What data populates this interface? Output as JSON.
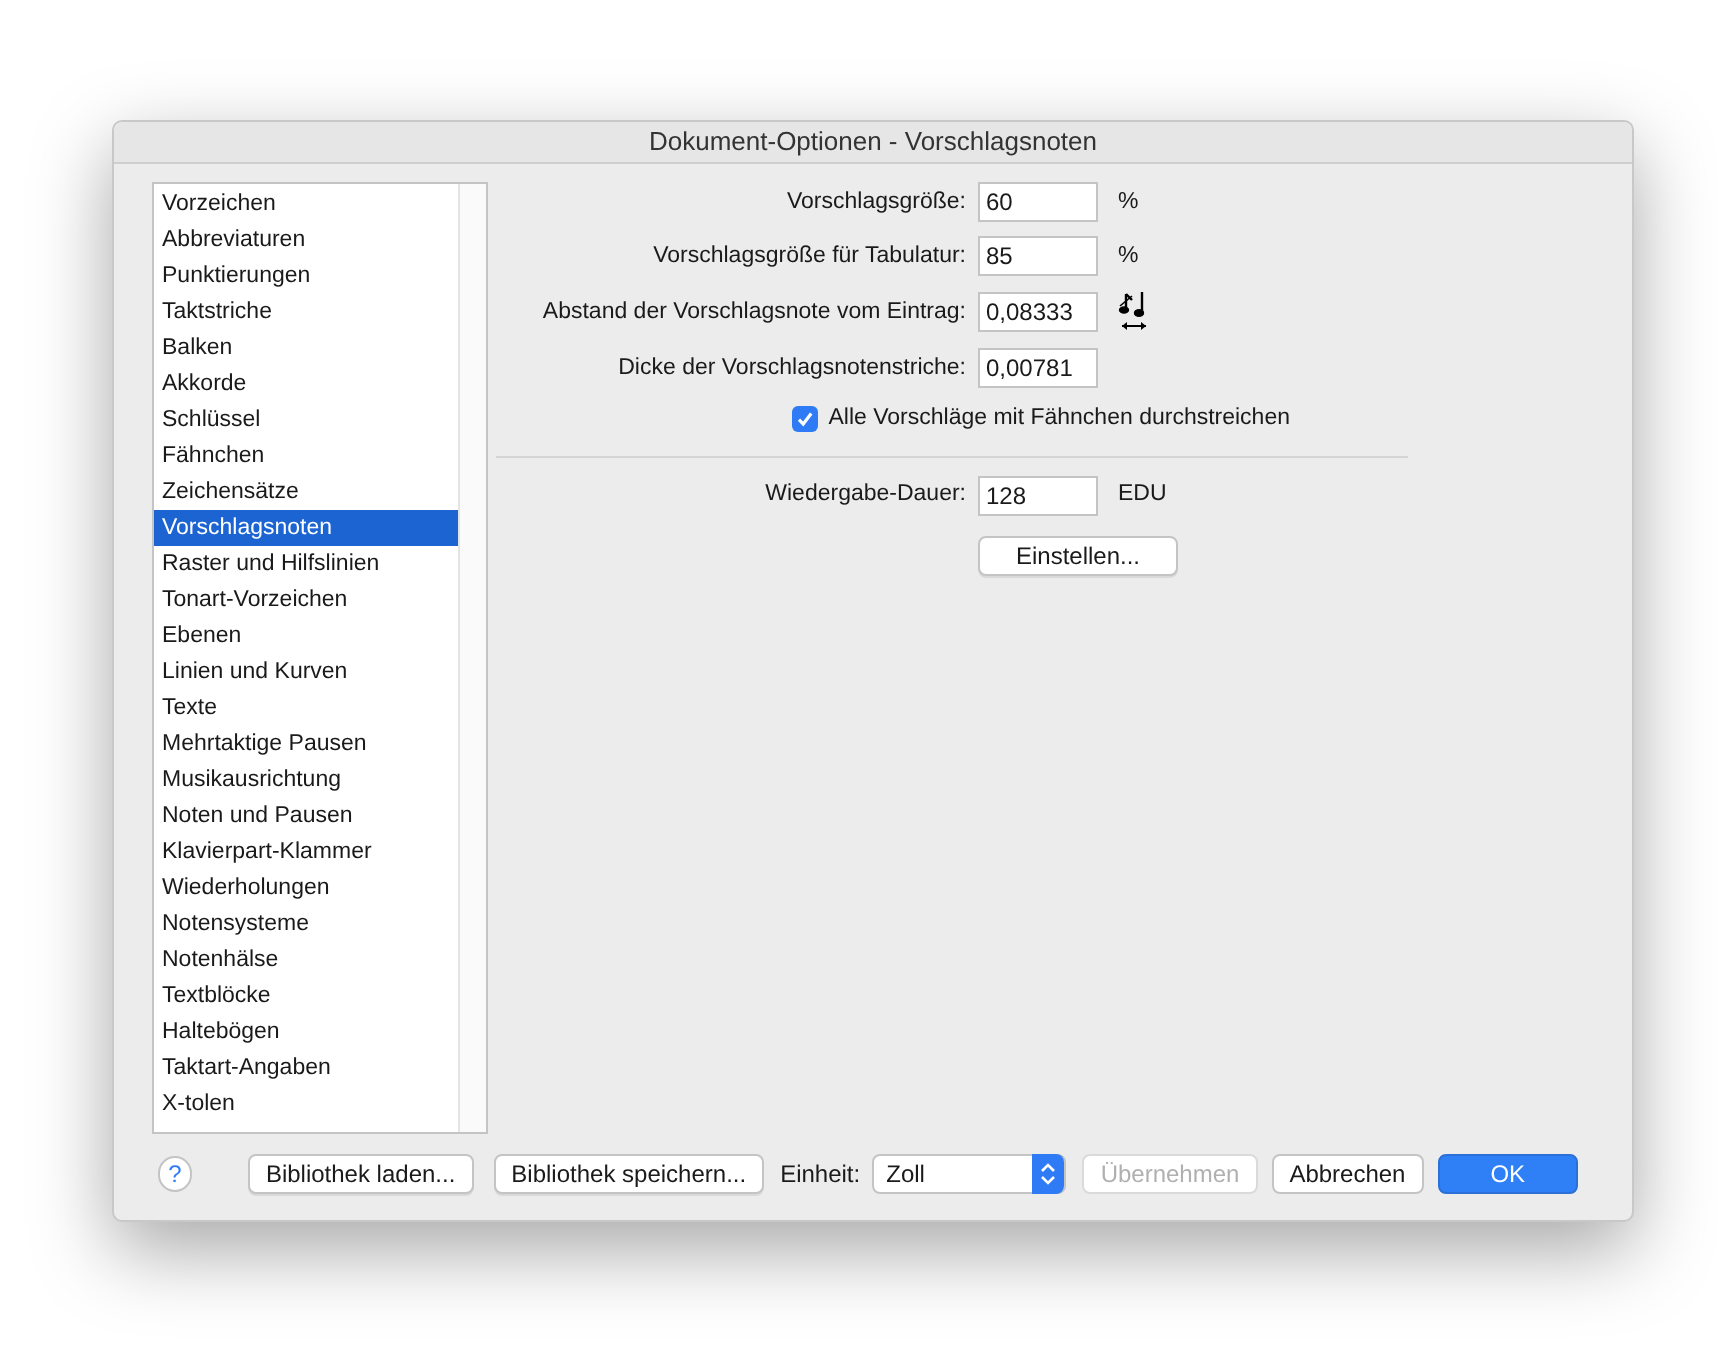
{
  "window": {
    "title": "Dokument-Optionen - Vorschlagsnoten"
  },
  "sidebar": {
    "items": [
      {
        "label": "Vorzeichen",
        "selected": false
      },
      {
        "label": "Abbreviaturen",
        "selected": false
      },
      {
        "label": "Punktierungen",
        "selected": false
      },
      {
        "label": "Taktstriche",
        "selected": false
      },
      {
        "label": "Balken",
        "selected": false
      },
      {
        "label": "Akkorde",
        "selected": false
      },
      {
        "label": "Schlüssel",
        "selected": false
      },
      {
        "label": "Fähnchen",
        "selected": false
      },
      {
        "label": "Zeichensätze",
        "selected": false
      },
      {
        "label": "Vorschlagsnoten",
        "selected": true
      },
      {
        "label": "Raster und Hilfslinien",
        "selected": false
      },
      {
        "label": "Tonart-Vorzeichen",
        "selected": false
      },
      {
        "label": "Ebenen",
        "selected": false
      },
      {
        "label": "Linien und Kurven",
        "selected": false
      },
      {
        "label": "Texte",
        "selected": false
      },
      {
        "label": "Mehrtaktige Pausen",
        "selected": false
      },
      {
        "label": "Musikausrichtung",
        "selected": false
      },
      {
        "label": "Noten und Pausen",
        "selected": false
      },
      {
        "label": "Klavierpart-Klammer",
        "selected": false
      },
      {
        "label": "Wiederholungen",
        "selected": false
      },
      {
        "label": "Notensysteme",
        "selected": false
      },
      {
        "label": "Notenhälse",
        "selected": false
      },
      {
        "label": "Textblöcke",
        "selected": false
      },
      {
        "label": "Haltebögen",
        "selected": false
      },
      {
        "label": "Taktart-Angaben",
        "selected": false
      },
      {
        "label": "X-tolen",
        "selected": false
      }
    ]
  },
  "fields": [
    {
      "label": "Vorschlagsgröße:",
      "value": "60",
      "kind": "unit",
      "unit": "%"
    },
    {
      "label": "Vorschlagsgröße für Tabulatur:",
      "value": "85",
      "kind": "unit",
      "unit": "%"
    },
    {
      "label": "Abstand der Vorschlagsnote vom Eintrag:",
      "value": "0,08333",
      "kind": "icon"
    },
    {
      "label": "Dicke der Vorschlagsnotenstriche:",
      "value": "0,00781",
      "kind": "plain"
    }
  ],
  "checkbox": {
    "label": "Alle Vorschläge mit Fähnchen durchstreichen",
    "checked": true
  },
  "playback": {
    "label": "Wiedergabe-Dauer:",
    "value": "128",
    "unit": "EDU",
    "button": "Einstellen..."
  },
  "footer": {
    "help": "?",
    "buttons_left": [
      "Bibliothek laden...",
      "Bibliothek speichern..."
    ],
    "unit_label": "Einheit:",
    "unit_value": "Zoll",
    "buttons_right": [
      {
        "label": "Übernehmen",
        "disabled": true,
        "kind": "normal"
      },
      {
        "label": "Abbrechen",
        "disabled": false,
        "kind": "normal"
      },
      {
        "label": "OK",
        "disabled": false,
        "kind": "default"
      }
    ]
  }
}
